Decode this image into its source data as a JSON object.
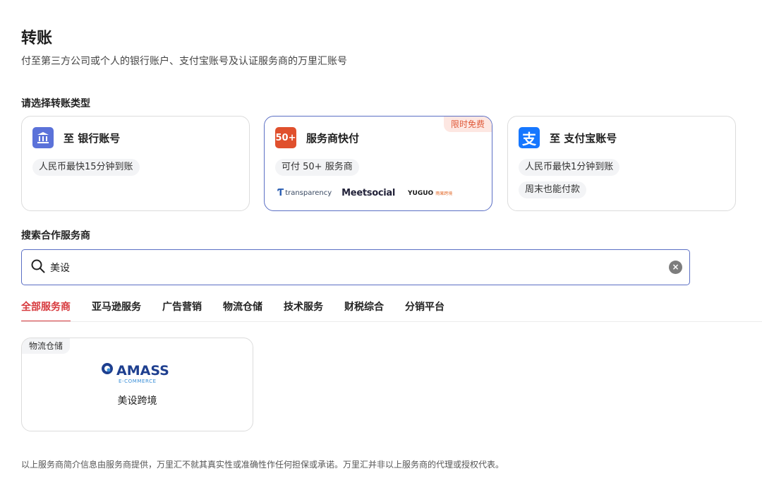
{
  "header": {
    "title": "转账",
    "subtitle": "付至第三方公司或个人的银行账户、支付宝账号及认证服务商的万里汇账号"
  },
  "transfer_types": {
    "section_title": "请选择转账类型",
    "cards": [
      {
        "title": "至 银行账号",
        "icon": "bank-icon",
        "tags": [
          "人民币最快15分钟到账"
        ]
      },
      {
        "title": "服务商快付",
        "icon_text": "50+",
        "promo": "限时免费",
        "tags": [
          "可付 50+ 服务商"
        ],
        "logos": {
          "transparency": "transparency",
          "meetsocial": "Meetsocial",
          "yuguo": "YUGUO",
          "yuguo_sub": "雨果跨境"
        }
      },
      {
        "title": "至 支付宝账号",
        "icon_text": "支",
        "tags": [
          "人民币最快1分钟到账",
          "周末也能付款"
        ]
      }
    ]
  },
  "search": {
    "section_title": "搜索合作服务商",
    "value": "美设",
    "placeholder": ""
  },
  "tabs": [
    "全部服务商",
    "亚马逊服务",
    "广告营销",
    "物流仓储",
    "技术服务",
    "财税综合",
    "分销平台"
  ],
  "results": [
    {
      "category": "物流仓储",
      "logo_text": "AMASS",
      "logo_sub": "E-COMMERCE",
      "name": "美设跨境"
    }
  ],
  "disclaimer": "以上服务商简介信息由服务商提供，万里汇不就其真实性或准确性作任何担保或承诺。万里汇并非以上服务商的代理或授权代表。",
  "colors": {
    "accent": "#5b6fc4",
    "tab_active": "#d7393d",
    "promo": "#e05a3a",
    "bank": "#5b72d9",
    "alipay": "#1677ff",
    "fifty": "#e0502d"
  }
}
